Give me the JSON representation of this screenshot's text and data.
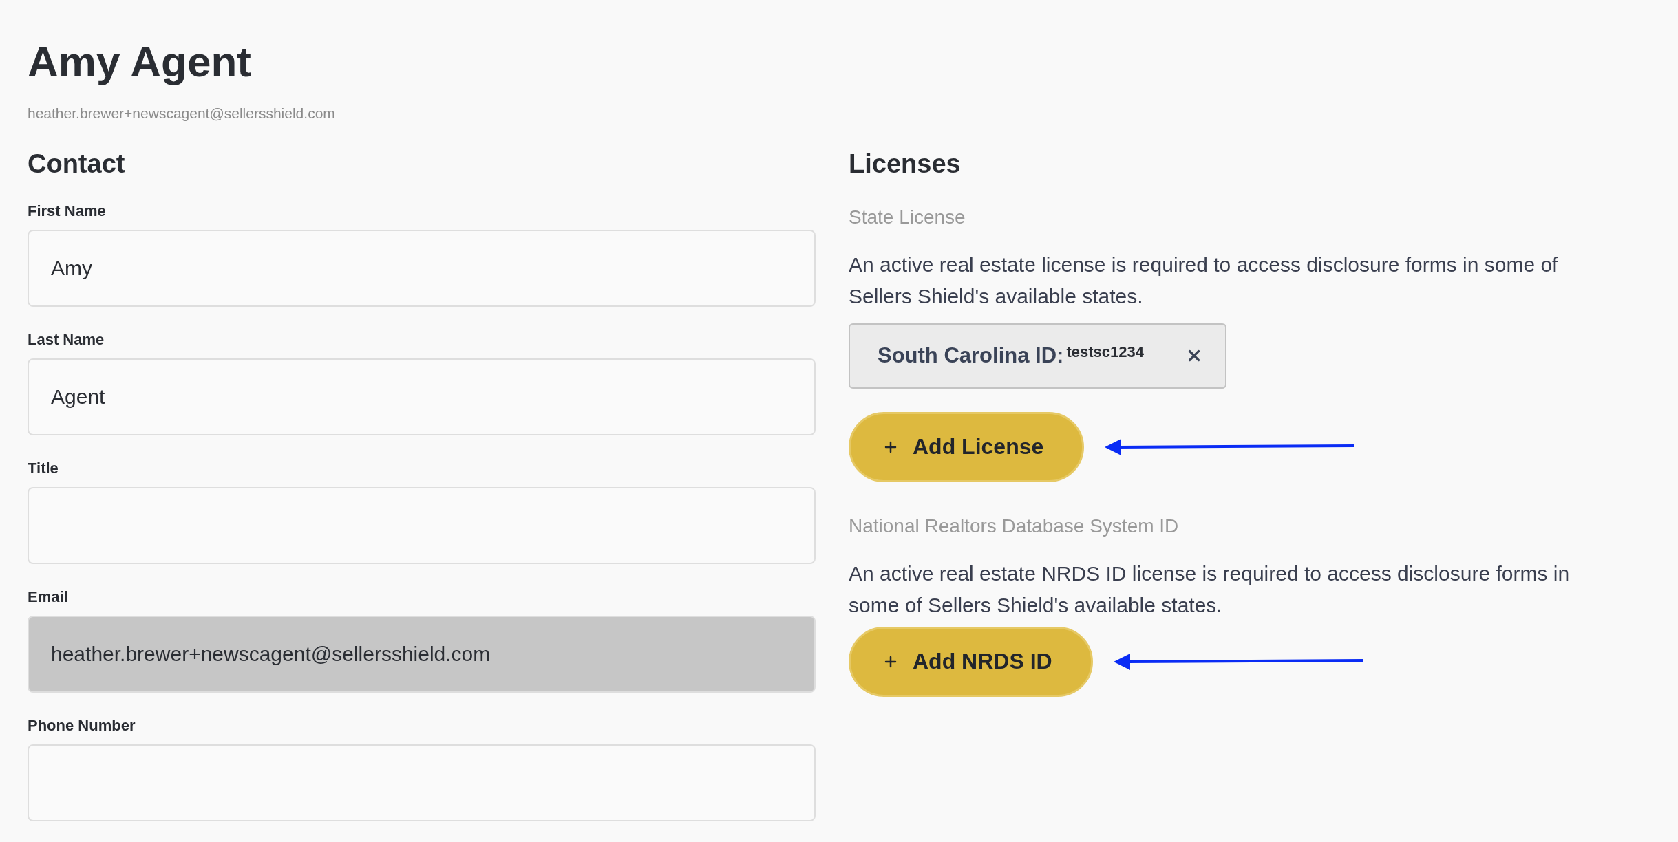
{
  "header": {
    "name": "Amy Agent",
    "email": "heather.brewer+newscagent@sellersshield.com"
  },
  "contact": {
    "heading": "Contact",
    "fields": [
      {
        "label": "First Name",
        "value": "Amy",
        "disabled": false
      },
      {
        "label": "Last Name",
        "value": "Agent",
        "disabled": false
      },
      {
        "label": "Title",
        "disabled": false
      },
      {
        "label": "Email",
        "value": "heather.brewer+newscagent@sellersshield.com",
        "disabled": true
      },
      {
        "label": "Phone Number",
        "disabled": false
      }
    ]
  },
  "licenses": {
    "heading": "Licenses",
    "sections": [
      {
        "title": "State License",
        "description": "An active real estate license is required to access disclosure forms in some of Sellers Shield's available states.",
        "chips": [
          {
            "label": "South Carolina ID:",
            "value": "testsc1234"
          }
        ],
        "button": "Add License"
      },
      {
        "title": "National Realtors Database System ID",
        "description": "An active real estate NRDS ID license is required to access disclosure forms in some of Sellers Shield's available states.",
        "button": "Add NRDS ID"
      }
    ]
  }
}
